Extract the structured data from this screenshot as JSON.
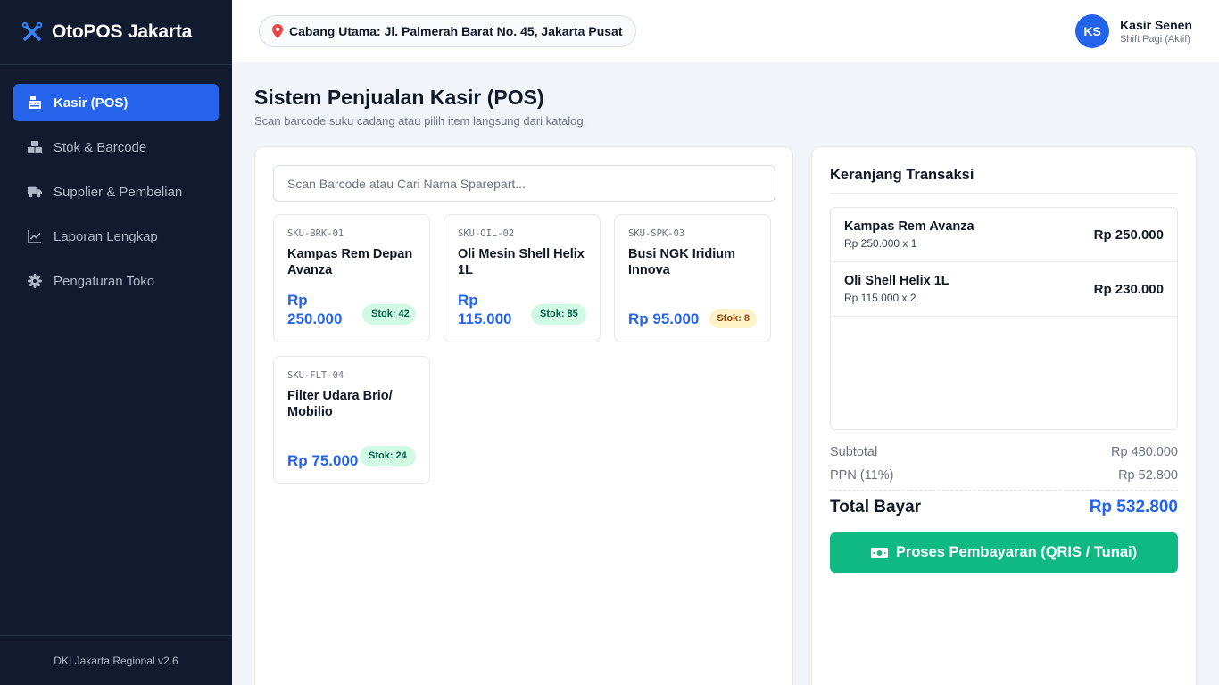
{
  "app": {
    "name": "OtoPOS Jakarta",
    "footer": "DKI Jakarta Regional v2.6"
  },
  "sidebar": {
    "items": [
      {
        "label": "Kasir (POS)",
        "icon": "cash-register-icon",
        "active": true
      },
      {
        "label": "Stok & Barcode",
        "icon": "boxes-icon",
        "active": false
      },
      {
        "label": "Supplier & Pembelian",
        "icon": "truck-icon",
        "active": false
      },
      {
        "label": "Laporan Lengkap",
        "icon": "line-chart-icon",
        "active": false
      },
      {
        "label": "Pengaturan Toko",
        "icon": "gear-icon",
        "active": false
      }
    ]
  },
  "header": {
    "branch": "Cabang Utama: Jl. Palmerah Barat No. 45, Jakarta Pusat",
    "user_initials": "KS",
    "user_name": "Kasir Senen",
    "user_shift": "Shift Pagi (Aktif)"
  },
  "page": {
    "title": "Sistem Penjualan Kasir (POS)",
    "subtitle": "Scan barcode suku cadang atau pilih item langsung dari katalog."
  },
  "search": {
    "placeholder": "Scan Barcode atau Cari Nama Sparepart...",
    "value": ""
  },
  "products": [
    {
      "sku": "SKU-BRK-01",
      "name": "Kampas Rem Depan Avanza",
      "price": "Rp 250.000",
      "stock": "Stok: 42",
      "stock_status": "ok"
    },
    {
      "sku": "SKU-OIL-02",
      "name": "Oli Mesin Shell Helix 1L",
      "price": "Rp 115.000",
      "stock": "Stok: 85",
      "stock_status": "ok"
    },
    {
      "sku": "SKU-SPK-03",
      "name": "Busi NGK Iridium Innova",
      "price": "Rp 95.000",
      "stock": "Stok: 8",
      "stock_status": "low"
    },
    {
      "sku": "SKU-FLT-04",
      "name": "Filter Udara Brio/ Mobilio",
      "price": "Rp 75.000",
      "stock": "Stok: 24",
      "stock_status": "ok"
    }
  ],
  "cart": {
    "title": "Keranjang Transaksi",
    "items": [
      {
        "name": "Kampas Rem Avanza",
        "detail": "Rp 250.000 x 1",
        "total": "Rp 250.000"
      },
      {
        "name": "Oli Shell Helix 1L",
        "detail": "Rp 115.000 x 2",
        "total": "Rp 230.000"
      }
    ],
    "subtotal_label": "Subtotal",
    "subtotal": "Rp 480.000",
    "tax_label": "PPN (11%)",
    "tax": "Rp 52.800",
    "total_label": "Total Bayar",
    "total": "Rp 532.800",
    "pay_label": "Proses Pembayaran (QRIS / Tunai)"
  },
  "colors": {
    "sidebar_bg": "#111a2e",
    "accent": "#2563eb",
    "success": "#10b981",
    "stock_ok_bg": "#d1fae5",
    "stock_low_bg": "#fef3c7"
  }
}
